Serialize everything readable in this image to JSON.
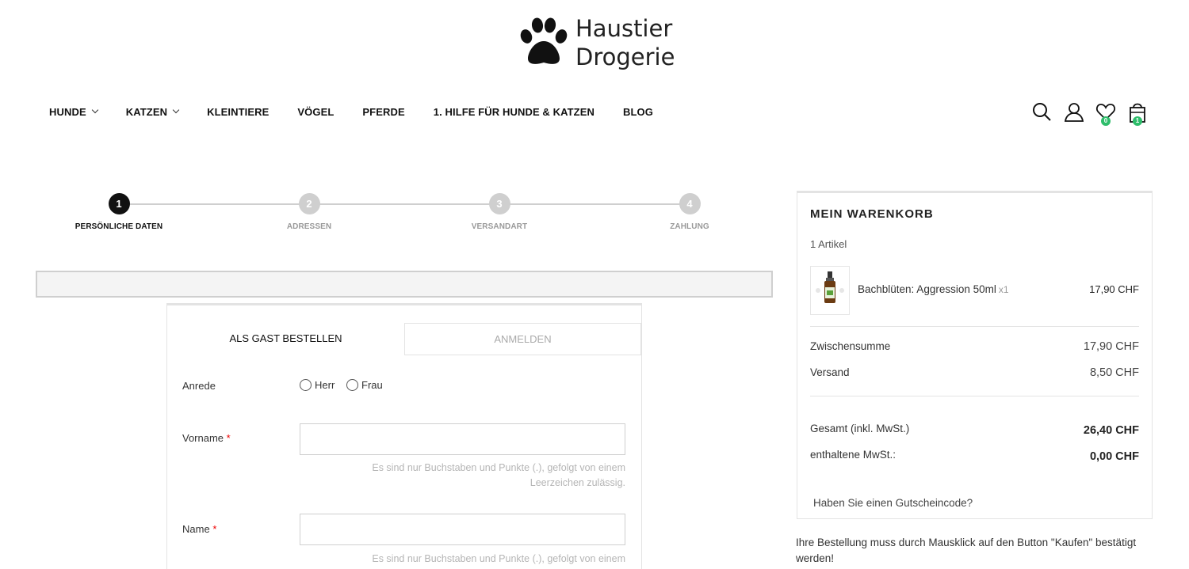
{
  "logo": {
    "line1": "Haustier",
    "line2": "Drogerie"
  },
  "nav": [
    {
      "label": "HUNDE",
      "dropdown": true
    },
    {
      "label": "KATZEN",
      "dropdown": true
    },
    {
      "label": "KLEINTIERE",
      "dropdown": false
    },
    {
      "label": "VÖGEL",
      "dropdown": false
    },
    {
      "label": "PFERDE",
      "dropdown": false
    },
    {
      "label": "1. HILFE FÜR HUNDE & KATZEN",
      "dropdown": false
    },
    {
      "label": "BLOG",
      "dropdown": false
    }
  ],
  "header_icons": {
    "wishlist_count": "0",
    "cart_count": "1"
  },
  "steps": [
    {
      "number": "1",
      "label": "PERSÖNLICHE DATEN",
      "active": true
    },
    {
      "number": "2",
      "label": "ADRESSEN",
      "active": false
    },
    {
      "number": "3",
      "label": "VERSANDART",
      "active": false
    },
    {
      "number": "4",
      "label": "ZAHLUNG",
      "active": false
    }
  ],
  "form": {
    "tab_guest": "ALS GAST BESTELLEN",
    "tab_login": "ANMELDEN",
    "salutation_label": "Anrede",
    "salutation_options": [
      "Herr",
      "Frau"
    ],
    "firstname_label": "Vorname",
    "firstname_value": "",
    "firstname_hint_1": "Es sind nur Buchstaben und Punkte (.), gefolgt von einem",
    "firstname_hint_2": "Leerzeichen zulässig.",
    "lastname_label": "Name",
    "lastname_value": "",
    "lastname_hint_1": "Es sind nur Buchstaben und Punkte (.), gefolgt von einem",
    "required_mark": "*"
  },
  "cart": {
    "title": "MEIN WARENKORB",
    "count": "1 Artikel",
    "item_name": "Bachblüten: Aggression 50ml",
    "item_qty": "x1",
    "item_price": "17,90 CHF",
    "subtotal_label": "Zwischensumme",
    "subtotal_value": "17,90 CHF",
    "shipping_label": "Versand",
    "shipping_value": "8,50 CHF",
    "total_label": "Gesamt (inkl. MwSt.)",
    "total_value": "26,40 CHF",
    "tax_label": "enthaltene MwSt.:",
    "tax_value": "0,00 CHF",
    "voucher": "Haben Sie einen Gutscheincode?"
  },
  "order_note": "Ihre Bestellung muss durch Mausklick auf den Button \"Kaufen\" bestätigt werden!",
  "colors": {
    "badge": "#2ebd6b",
    "active_step": "#111111",
    "inactive_step": "#cfcfcf",
    "required": "#ee0000"
  }
}
